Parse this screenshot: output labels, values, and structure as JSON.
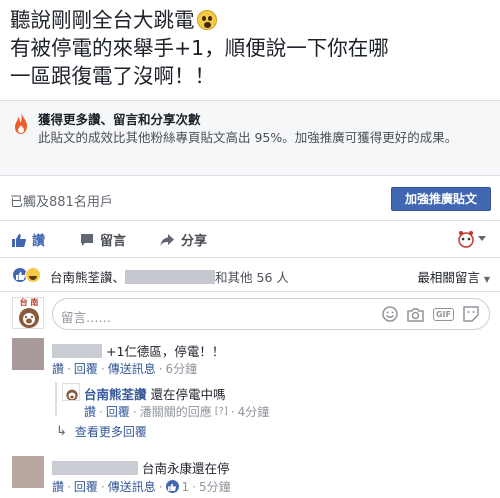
{
  "post": {
    "line1": "聽說剛剛全台大跳電",
    "line2": "有被停電的來舉手+1，順便說一下你在哪",
    "line3": "一區跟復電了沒啊！！"
  },
  "insight": {
    "title": "獲得更多讚、留言和分享次數",
    "body": "此貼文的成效比其他粉絲專頁貼文高出 95%。加強推廣可獲得更好的成果。"
  },
  "reach": {
    "text": "已觸及881名用戶",
    "boost_label": "加強推廣貼文"
  },
  "actions": {
    "like": "讚",
    "comment": "留言",
    "share": "分享"
  },
  "summary": {
    "first_reactor": "台南熊荃讚、",
    "others": "和其他 56 人",
    "sort_label": "最相關留言"
  },
  "composer": {
    "placeholder": "留言……",
    "avatar_text": "台 南"
  },
  "comments": [
    {
      "text": "+1仁德區，停電！！",
      "reply": "讚",
      "reply2": "回覆",
      "send": "傳送訊息",
      "time": "6分鐘"
    },
    {
      "author": "台南熊荃讚",
      "text": "還在停電中嗎",
      "like": "讚",
      "reply": "回覆",
      "responder": "潘關關的回應",
      "marker": "[?]",
      "time": "4分鐘"
    },
    {
      "text": "台南永康還在停",
      "like": "讚",
      "reply": "回覆",
      "send": "傳送訊息",
      "like_count": "1",
      "time": "5分鐘"
    }
  ],
  "more_replies": "查看更多回覆",
  "colors": {
    "link": "#365899",
    "button": "#4267b2",
    "like_reaction": "#4267b2",
    "haha_reaction": "#f7c948"
  }
}
